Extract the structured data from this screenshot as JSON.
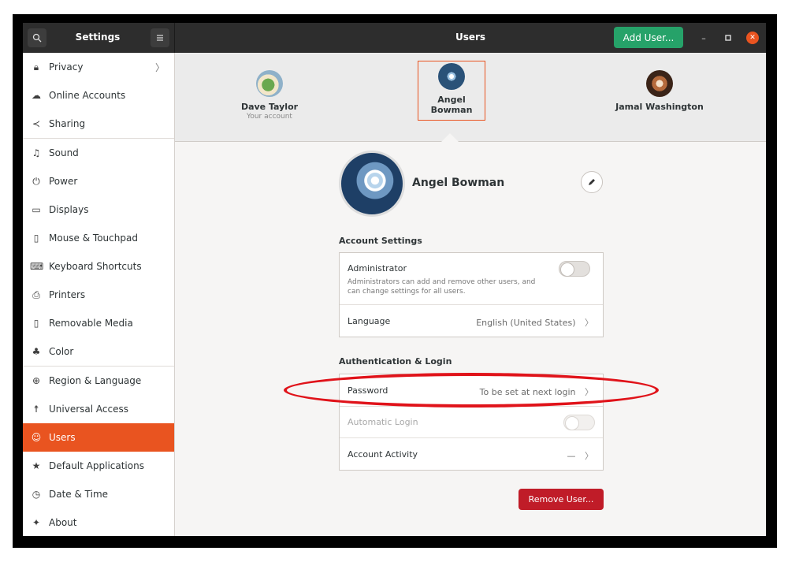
{
  "header": {
    "search_icon": "search-icon",
    "settings_title": "Settings",
    "menu_icon": "hamburger-menu-icon",
    "main_title": "Users",
    "add_user_label": "Add User...",
    "window_controls": [
      "minimize-icon",
      "maximize-icon",
      "close-icon"
    ]
  },
  "sidebar": {
    "items": [
      {
        "label": "Privacy",
        "icon": "lock-icon",
        "glyph": "🔒︎",
        "chevron": "〉"
      },
      {
        "label": "Online Accounts",
        "icon": "cloud-icon",
        "glyph": "☁"
      },
      {
        "label": "Sharing",
        "icon": "share-icon",
        "glyph": "≺"
      },
      {
        "label": "Sound",
        "icon": "music-note-icon",
        "glyph": "♫"
      },
      {
        "label": "Power",
        "icon": "power-icon",
        "glyph": "⏻"
      },
      {
        "label": "Displays",
        "icon": "display-icon",
        "glyph": "▭"
      },
      {
        "label": "Mouse & Touchpad",
        "icon": "mouse-icon",
        "glyph": "▯"
      },
      {
        "label": "Keyboard Shortcuts",
        "icon": "keyboard-icon",
        "glyph": "⌨"
      },
      {
        "label": "Printers",
        "icon": "printer-icon",
        "glyph": "⎙"
      },
      {
        "label": "Removable Media",
        "icon": "removable-media-icon",
        "glyph": "▯"
      },
      {
        "label": "Color",
        "icon": "color-icon",
        "glyph": "♣"
      },
      {
        "label": "Region & Language",
        "icon": "globe-icon",
        "glyph": "⊕"
      },
      {
        "label": "Universal Access",
        "icon": "accessibility-icon",
        "glyph": "☨"
      },
      {
        "label": "Users",
        "icon": "users-icon",
        "glyph": "☺"
      },
      {
        "label": "Default Applications",
        "icon": "star-icon",
        "glyph": "★"
      },
      {
        "label": "Date & Time",
        "icon": "clock-icon",
        "glyph": "◷"
      },
      {
        "label": "About",
        "icon": "about-icon",
        "glyph": "✦"
      }
    ],
    "active_item": "Users"
  },
  "users": [
    {
      "name": "Dave Taylor",
      "subtitle": "Your account",
      "selected": false
    },
    {
      "name": "Angel Bowman",
      "subtitle": "",
      "selected": true
    },
    {
      "name": "Jamal Washington",
      "subtitle": "",
      "selected": false
    }
  ],
  "details": {
    "name": "Angel Bowman",
    "edit_icon": "pencil-icon",
    "account_settings_title": "Account Settings",
    "administrator_label": "Administrator",
    "administrator_desc": "Administrators can add and remove other users, and can settings for all users.",
    "administrator_desc_line1": "Administrators can add and remove other users, and",
    "administrator_desc_line2": "can change settings for all users.",
    "administrator_enabled": false,
    "language_label": "Language",
    "language_value": "English (United States)",
    "auth_title": "Authentication & Login",
    "password_label": "Password",
    "password_value": "To be set at next login",
    "automatic_login_label": "Automatic Login",
    "automatic_login_enabled": false,
    "account_activity_label": "Account Activity",
    "account_activity_value": "—",
    "chevron": "〉",
    "remove_user_label": "Remove User..."
  },
  "colors": {
    "accent": "#e95420",
    "add_user_green": "#26a269",
    "remove_red": "#c01c28",
    "annotation_red": "#e0131a"
  }
}
